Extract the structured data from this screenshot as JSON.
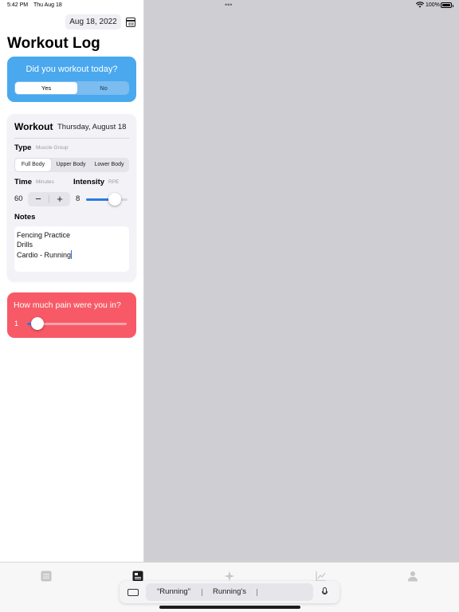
{
  "status_bar": {
    "time": "5:42 PM",
    "date": "Thu Aug 18",
    "battery": "100%"
  },
  "header": {
    "date_button": "Aug 18, 2022",
    "title": "Workout Log",
    "calendar_icon": "calendar-icon"
  },
  "did_workout": {
    "question": "Did you workout today?",
    "options": [
      "Yes",
      "No"
    ],
    "selected": "Yes",
    "color": "#4aa8ee"
  },
  "workout": {
    "title": "Workout",
    "date": "Thursday, August 18",
    "type": {
      "label": "Type",
      "sublabel": "Muscle Group",
      "options": [
        "Full Body",
        "Upper Body",
        "Lower Body"
      ],
      "selected": "Full Body"
    },
    "time": {
      "label": "Time",
      "sublabel": "Minutes",
      "value": "60",
      "minus": "−",
      "plus": "+"
    },
    "intensity": {
      "label": "Intensity",
      "sublabel": "RPE",
      "value": "8",
      "slider_fraction": 0.7
    },
    "notes": {
      "label": "Notes",
      "lines": [
        "Fencing Practice",
        "Drills",
        "Cardio - Running"
      ]
    }
  },
  "pain": {
    "question": "How much pain were you in?",
    "value": "1",
    "slider_fraction": 0.1,
    "color": "#f75a66"
  },
  "tab_bar": {
    "tabs": [
      {
        "icon": "list-icon",
        "selected": false
      },
      {
        "icon": "log-icon",
        "selected": true
      },
      {
        "icon": "sparkle-icon",
        "selected": false
      },
      {
        "icon": "chart-icon",
        "selected": false
      },
      {
        "icon": "person-icon",
        "selected": false
      }
    ]
  },
  "keyboard_suggestions": {
    "items": [
      "“Running”",
      "Running's",
      ""
    ],
    "left_icon": "keyboard-icon",
    "right_icon": "microphone-icon"
  }
}
